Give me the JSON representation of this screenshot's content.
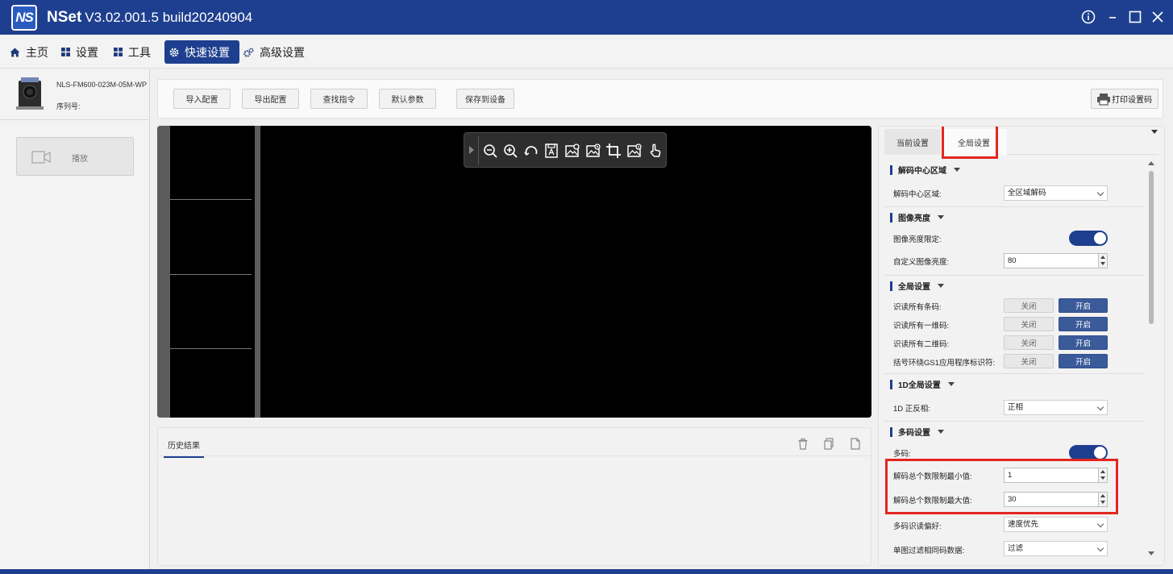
{
  "app": {
    "name": "NSet",
    "version": "V3.02.001.5 build20240904",
    "logo_text": "NS"
  },
  "menu": [
    {
      "label": "主页",
      "icon": "home-icon"
    },
    {
      "label": "设置",
      "icon": "grid-icon"
    },
    {
      "label": "工具",
      "icon": "grid-icon"
    },
    {
      "label": "快速设置",
      "icon": "gear-icon",
      "active": true
    },
    {
      "label": "高级设置",
      "icon": "gears-icon"
    }
  ],
  "device": {
    "model": "NLS-FM600-023M-05M-WP",
    "serial_label": "序列号:",
    "play_label": "播放"
  },
  "toolbar": {
    "import": "导入配置",
    "export": "导出配置",
    "find_cmd": "查找指令",
    "default_params": "默认参数",
    "save_device": "保存到设备",
    "print_code": "打印设置码"
  },
  "history": {
    "tab": "历史结果"
  },
  "settings": {
    "tabs": [
      "当前设置",
      "全局设置"
    ],
    "active_tab": 1,
    "sections": {
      "decode_area": {
        "title": "解码中心区域",
        "label": "解码中心区域:",
        "value": "全区域解码"
      },
      "brightness": {
        "title": "图像亮度",
        "limit_label": "图像亮度限定:",
        "limit_on": true,
        "custom_label": "自定义图像亮度:",
        "custom_value": "80"
      },
      "global": {
        "title": "全局设置",
        "off": "关闭",
        "on": "开启",
        "rows": [
          "识读所有条码:",
          "识读所有一维码:",
          "识读所有二维码:",
          "括号环绕GS1应用程序标识符:"
        ]
      },
      "oned": {
        "title": "1D全局设置",
        "label": "1D 正反相:",
        "value": "正相"
      },
      "multi": {
        "title": "多码设置",
        "multi_label": "多码:",
        "multi_on": true,
        "min_label": "解码总个数限制最小值:",
        "min_value": "1",
        "max_label": "解码总个数限制最大值:",
        "max_value": "30",
        "pref_label": "多码识读偏好:",
        "pref_value": "速度优先",
        "filter_label": "单图过滤相同码数据:",
        "filter_value": "过滤"
      }
    }
  },
  "colors": {
    "titlebar": "#1e3f8f",
    "accent": "#1e3f8f",
    "highlight": "#e3261f"
  }
}
